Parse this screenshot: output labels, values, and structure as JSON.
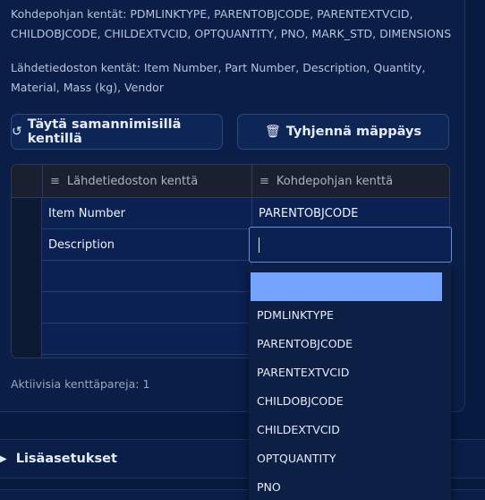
{
  "info": {
    "target_fields": "Kohdepohjan kentät: PDMLINKTYPE, PARENTOBJCODE, PARENTEXTVCID, CHILDOBJCODE, CHILDEXTVCID, OPTQUANTITY, PNO, MARK_STD, DIMENSIONS",
    "source_fields": "Lähdetiedoston kentät: Item Number, Part Number, Description, Quantity, Material, Mass (kg), Vendor"
  },
  "buttons": {
    "fill_icon": "↺",
    "fill_label": "Täytä samannimisillä kentillä",
    "clear_icon": "🗑",
    "clear_label": "Tyhjennä mäppäys"
  },
  "grid": {
    "header_icon": "≡",
    "columns": [
      "Lähdetiedoston kenttä",
      "Kohdepohjan kenttä"
    ],
    "rows": [
      {
        "source": "Item Number",
        "target": "PARENTOBJCODE"
      },
      {
        "source": "Description",
        "target": ""
      },
      {
        "source": "",
        "target": ""
      },
      {
        "source": "",
        "target": ""
      },
      {
        "source": "",
        "target": ""
      }
    ]
  },
  "status": {
    "active_pairs": "Aktiivisia kenttäpareja: 1"
  },
  "section": {
    "label": "Lisäasetukset",
    "icon": "chevron-right-icon"
  },
  "dropdown": {
    "options": [
      "",
      "PDMLINKTYPE",
      "PARENTOBJCODE",
      "PARENTEXTVCID",
      "CHILDOBJCODE",
      "CHILDEXTVCID",
      "OPTQUANTITY",
      "PNO"
    ],
    "highlight_color": "#73a3ff"
  }
}
